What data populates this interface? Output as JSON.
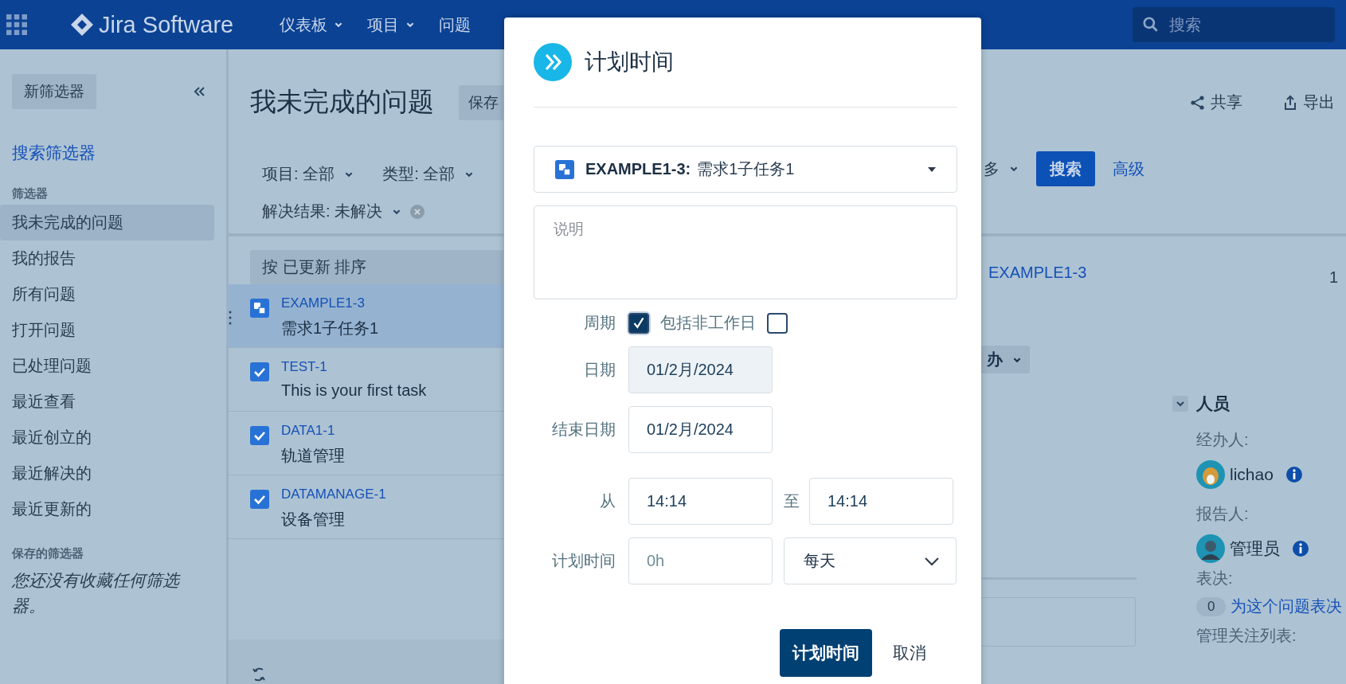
{
  "topbar": {
    "product": "Jira Software",
    "nav": [
      {
        "label": "仪表板",
        "has_menu": true
      },
      {
        "label": "项目",
        "has_menu": true
      },
      {
        "label": "问题",
        "has_menu": false
      }
    ],
    "search": {
      "placeholder": "搜索"
    }
  },
  "sidebar": {
    "new_filter": "新筛选器",
    "search_filters": "搜索筛选器",
    "section": "筛选器",
    "items": [
      {
        "label": "我未完成的问题",
        "selected": true
      },
      {
        "label": "我的报告",
        "selected": false
      },
      {
        "label": "所有问题",
        "selected": false
      },
      {
        "label": "打开问题",
        "selected": false
      },
      {
        "label": "已处理问题",
        "selected": false
      },
      {
        "label": "最近查看",
        "selected": false
      },
      {
        "label": "最近创立的",
        "selected": false
      },
      {
        "label": "最近解决的",
        "selected": false
      },
      {
        "label": "最近更新的",
        "selected": false
      }
    ],
    "saved_heading": "保存的筛选器",
    "saved_empty": "您还没有收藏任何筛选器。"
  },
  "header": {
    "title": "我未完成的问题",
    "save": "保存",
    "actions": [
      {
        "kind": "share",
        "label": "共享"
      },
      {
        "kind": "export",
        "label": "导出"
      }
    ]
  },
  "filters": [
    {
      "label": "项目: 全部",
      "clearable": false
    },
    {
      "label": "类型: 全部",
      "clearable": false
    },
    {
      "label": "解决结果: 未解决",
      "clearable": true
    }
  ],
  "more": "多",
  "search_button": "搜索",
  "advanced": "高级",
  "list": {
    "sort": "按 已更新 排序",
    "issues": [
      {
        "key": "EXAMPLE1-3",
        "summary": "需求1子任务1",
        "kind": "subtask",
        "selected": true
      },
      {
        "key": "TEST-1",
        "summary": "This is your first task",
        "kind": "task",
        "selected": false
      },
      {
        "key": "DATA1-1",
        "summary": "轨道管理",
        "kind": "task",
        "selected": false
      },
      {
        "key": "DATAMANAGE-1",
        "summary": "设备管理",
        "kind": "task",
        "selected": false
      }
    ]
  },
  "detail": {
    "key": "EXAMPLE1-3",
    "status": "办",
    "count": "1"
  },
  "people": {
    "heading": "人员",
    "expanded": true,
    "assignee_label": "经办人:",
    "assignee": "lichao",
    "reporter_label": "报告人:",
    "reporter": "管理员",
    "votes_label": "表决:",
    "votes": "0",
    "vote_link": "为这个问题表决",
    "watchers_label": "管理关注列表:"
  },
  "dialog": {
    "title": "计划时间",
    "issue": {
      "key": "EXAMPLE1-3:",
      "summary": "需求1子任务1",
      "kind": "subtask"
    },
    "description": {
      "placeholder": "说明"
    },
    "recurring": {
      "label": "周期",
      "checked": true
    },
    "non_working": {
      "label": "包括非工作日",
      "checked": false
    },
    "date": {
      "label": "日期",
      "value": "01/2月/2024",
      "active": true
    },
    "end_date": {
      "label": "结束日期",
      "value": "01/2月/2024",
      "active": false
    },
    "from": {
      "label": "从",
      "value": "14:14"
    },
    "to": {
      "label": "至",
      "value": "14:14"
    },
    "planned": {
      "label": "计划时间",
      "placeholder": "0h"
    },
    "period": {
      "value": "每天"
    },
    "buttons": [
      {
        "label": "计划时间",
        "kind": "primary"
      },
      {
        "label": "取消",
        "kind": "link"
      }
    ]
  }
}
